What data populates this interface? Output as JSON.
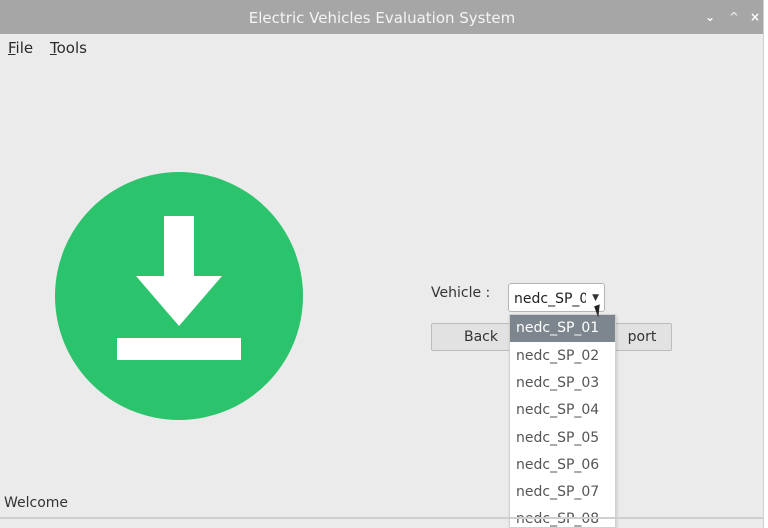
{
  "window": {
    "title": "Electric Vehicles Evaluation System",
    "controls": {
      "minimize": "⌄",
      "maximize": "^",
      "close": "×"
    }
  },
  "menu": {
    "file_first": "F",
    "file_rest": "ile",
    "tools_first": "T",
    "tools_rest": "ools"
  },
  "logo": {
    "icon": "download-icon",
    "color": "#2bc36b"
  },
  "form": {
    "vehicle_label": "Vehicle :",
    "vehicle_value": "nedc_SP_0",
    "back_button": "Back",
    "report_button": "port"
  },
  "dropdown": {
    "options": [
      "nedc_SP_01",
      "nedc_SP_02",
      "nedc_SP_03",
      "nedc_SP_04",
      "nedc_SP_05",
      "nedc_SP_06",
      "nedc_SP_07",
      "nedc_SP_08"
    ],
    "selected_index": 0
  },
  "status": {
    "text": "Welcome"
  },
  "colors": {
    "titlebar": "#a6a6a6",
    "background": "#ebebeb",
    "accent": "#2bc36b",
    "selection": "#7d868e"
  }
}
